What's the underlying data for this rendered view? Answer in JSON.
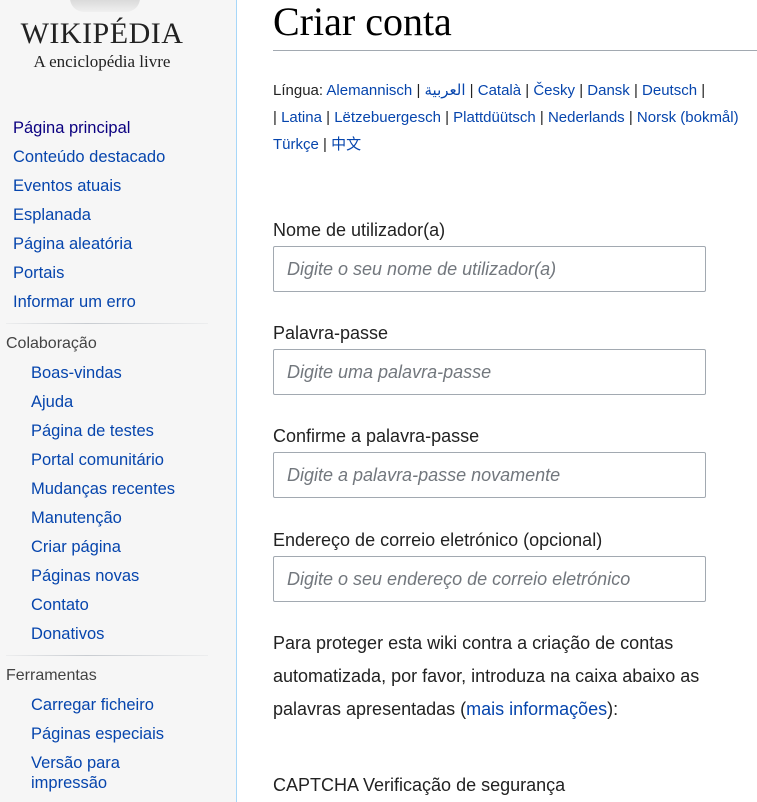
{
  "logo": {
    "wordmark": "WIKIPÉDIA",
    "tagline": "A enciclopédia livre"
  },
  "main_nav": [
    {
      "label": "Página principal",
      "color": "#0b0080"
    },
    {
      "label": "Conteúdo destacado"
    },
    {
      "label": "Eventos atuais"
    },
    {
      "label": "Esplanada"
    },
    {
      "label": "Página aleatória"
    },
    {
      "label": "Portais"
    },
    {
      "label": "Informar um erro"
    }
  ],
  "collaboration": {
    "heading": "Colaboração",
    "items": [
      {
        "label": "Boas-vindas"
      },
      {
        "label": "Ajuda"
      },
      {
        "label": "Página de testes"
      },
      {
        "label": "Portal comunitário"
      },
      {
        "label": "Mudanças recentes"
      },
      {
        "label": "Manutenção"
      },
      {
        "label": "Criar página"
      },
      {
        "label": "Páginas novas"
      },
      {
        "label": "Contato"
      },
      {
        "label": "Donativos"
      }
    ]
  },
  "tools": {
    "heading": "Ferramentas",
    "items": [
      {
        "label": "Carregar ficheiro"
      },
      {
        "label": "Páginas especiais"
      },
      {
        "label": "Versão para impressão"
      }
    ]
  },
  "page": {
    "title": "Criar conta",
    "language_label": "Língua:",
    "languages_line1": [
      "Alemannisch",
      "العربية",
      "Català",
      "Česky",
      "Dansk",
      "Deutsch"
    ],
    "languages_line2": [
      "Latina",
      "Lëtzebuergesch",
      "Plattdüütsch",
      "Nederlands",
      "Norsk (bokmål)"
    ],
    "languages_line3": [
      "Türkçe",
      "中文"
    ]
  },
  "form": {
    "username": {
      "label": "Nome de utilizador(a)",
      "placeholder": "Digite o seu nome de utilizador(a)",
      "value": ""
    },
    "password": {
      "label": "Palavra-passe",
      "placeholder": "Digite uma palavra-passe",
      "value": ""
    },
    "password_confirm": {
      "label": "Confirme a palavra-passe",
      "placeholder": "Digite a palavra-passe novamente",
      "value": ""
    },
    "email": {
      "label": "Endereço de correio eletrónico (opcional)",
      "placeholder": "Digite o seu endereço de correio eletrónico",
      "value": ""
    }
  },
  "captcha": {
    "text_before": "Para proteger esta wiki contra a criação de contas automatizada, por favor, introduza na caixa abaixo as palavras apresentadas (",
    "link": "mais informações",
    "text_after": "):",
    "heading": "CAPTCHA Verificação de segurança"
  },
  "colors": {
    "link": "#0645ad",
    "link_visited": "#0b0080",
    "sidebar_bg": "#f6f6f6",
    "sidebar_border": "#a7d7f9",
    "input_border": "#a2a9b1"
  }
}
